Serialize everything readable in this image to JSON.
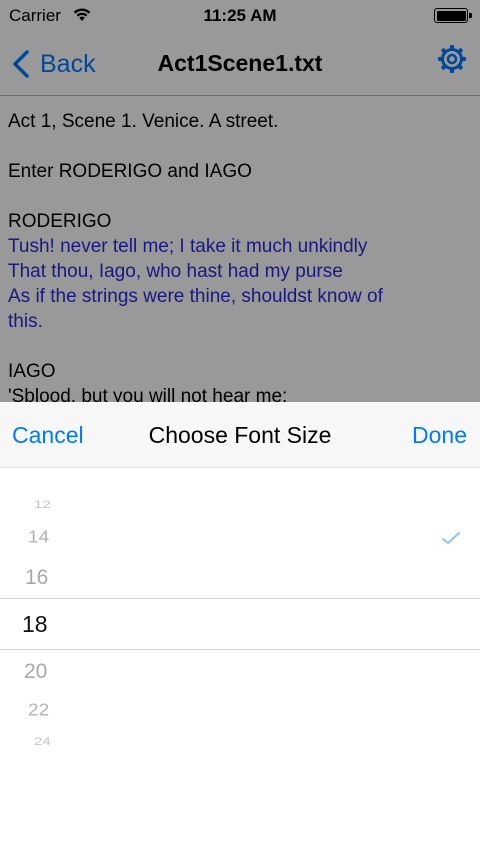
{
  "status_bar": {
    "carrier": "Carrier",
    "time": "11:25 AM"
  },
  "nav": {
    "back_label": "Back",
    "title": "Act1Scene1.txt"
  },
  "document": {
    "heading": "Act 1, Scene 1. Venice. A street.",
    "stage_direction": "Enter RODERIGO and IAGO",
    "speaker1": "RODERIGO",
    "speech1": [
      "Tush! never tell me; I take it much unkindly",
      "That thou, Iago, who hast had my purse",
      "As if the strings were thine, shouldst know of",
      "this."
    ],
    "speaker2": "IAGO",
    "speech2_partial": "'Sblood, but you will not hear me:"
  },
  "sheet": {
    "cancel_label": "Cancel",
    "title": "Choose Font Size",
    "done_label": "Done"
  },
  "picker": {
    "options": [
      "12",
      "14",
      "16",
      "18",
      "20",
      "22",
      "24"
    ],
    "selected": "18",
    "checked": "14"
  },
  "colors": {
    "accent": "#007aff",
    "speech_text": "#2b2bdb"
  }
}
